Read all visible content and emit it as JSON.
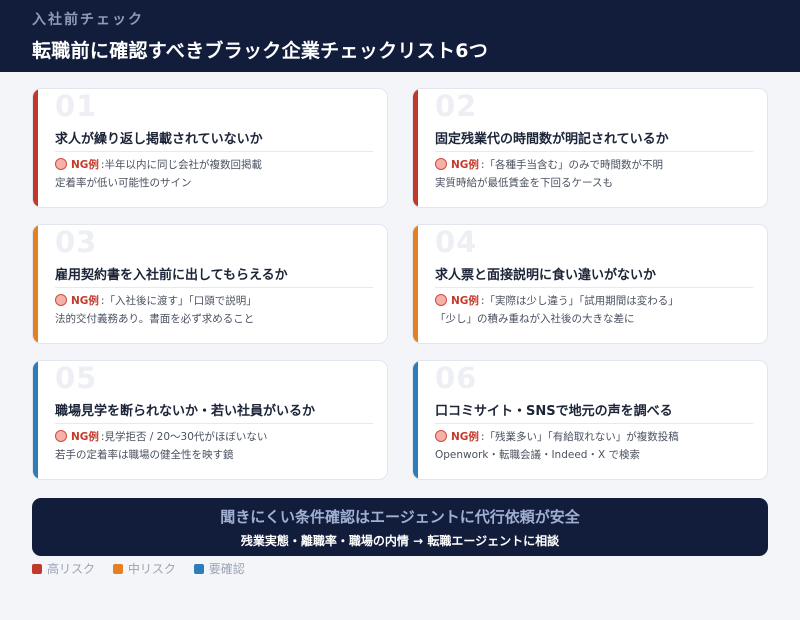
{
  "header": {
    "kicker": "入社前チェック",
    "title": "転職前に確認すべきブラック企業チェックリスト6つ"
  },
  "colors": {
    "high": "#c0392b",
    "medium": "#e67e22",
    "check": "#2d7eb8",
    "navy": "#121d3b"
  },
  "cards": [
    {
      "num": "01",
      "risk": "high",
      "heading": "求人が繰り返し掲載されていないか",
      "ng_label": "NG例",
      "ng_text": ":半年以内に同じ会社が複数回掲載",
      "note": "定着率が低い可能性のサイン"
    },
    {
      "num": "02",
      "risk": "high",
      "heading": "固定残業代の時間数が明記されているか",
      "ng_label": "NG例",
      "ng_text": ":「各種手当含む」のみで時間数が不明",
      "note": "実質時給が最低賃金を下回るケースも"
    },
    {
      "num": "03",
      "risk": "medium",
      "heading": "雇用契約書を入社前に出してもらえるか",
      "ng_label": "NG例",
      "ng_text": ":「入社後に渡す」「口頭で説明」",
      "note": "法的交付義務あり。書面を必ず求めること"
    },
    {
      "num": "04",
      "risk": "medium",
      "heading": "求人票と面接説明に食い違いがないか",
      "ng_label": "NG例",
      "ng_text": ":「実際は少し違う」「試用期間は変わる」",
      "note": "「少し」の積み重ねが入社後の大きな差に"
    },
    {
      "num": "05",
      "risk": "check",
      "heading": "職場見学を断られないか・若い社員がいるか",
      "ng_label": "NG例",
      "ng_text": ":見学拒否 / 20〜30代がほぼいない",
      "note": "若手の定着率は職場の健全性を映す鏡"
    },
    {
      "num": "06",
      "risk": "check",
      "heading": "口コミサイト・SNSで地元の声を調べる",
      "ng_label": "NG例",
      "ng_text": ":「残業多い」「有給取れない」が複数投稿",
      "note": "Openwork・転職会議・Indeed・X で検索"
    }
  ],
  "cta": {
    "main": "聞きにくい条件確認はエージェントに代行依頼が安全",
    "sub": "残業実態・離職率・職場の内情 → 転職エージェントに相談"
  },
  "legend": [
    {
      "label": "高リスク",
      "risk": "high"
    },
    {
      "label": "中リスク",
      "risk": "medium"
    },
    {
      "label": "要確認",
      "risk": "check"
    }
  ]
}
